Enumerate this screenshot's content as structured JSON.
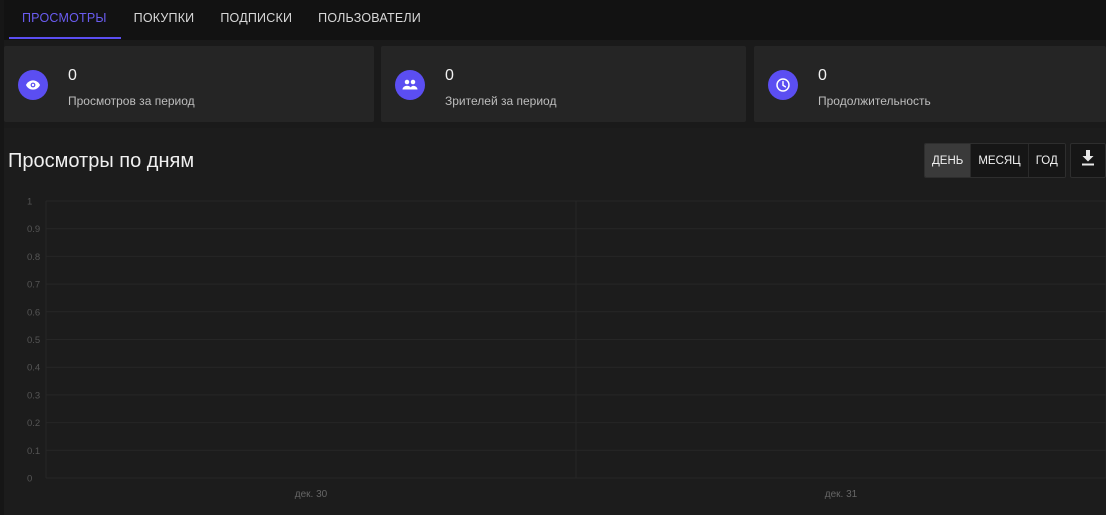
{
  "tabs": [
    {
      "label": "ПРОСМОТРЫ",
      "active": true
    },
    {
      "label": "ПОКУПКИ",
      "active": false
    },
    {
      "label": "ПОДПИСКИ",
      "active": false
    },
    {
      "label": "ПОЛЬЗОВАТЕЛИ",
      "active": false
    }
  ],
  "cards": [
    {
      "icon": "eye-icon",
      "value": "0",
      "label": "Просмотров за период"
    },
    {
      "icon": "users-icon",
      "value": "0",
      "label": "Зрителей за период"
    },
    {
      "icon": "clock-icon",
      "value": "0",
      "label": "Продолжительность"
    }
  ],
  "panel": {
    "title": "Просмотры по дням",
    "period_buttons": [
      {
        "label": "ДЕНЬ",
        "active": true
      },
      {
        "label": "МЕСЯЦ",
        "active": false
      },
      {
        "label": "ГОД",
        "active": false
      }
    ],
    "download_icon": "download-icon"
  },
  "colors": {
    "accent": "#5b4ef2",
    "background": "#1a1a1a",
    "card": "#252525"
  },
  "chart_data": {
    "type": "line",
    "x": [
      "дек. 30",
      "дек. 31"
    ],
    "series": [
      {
        "values": [
          0,
          0
        ]
      }
    ],
    "ylim": [
      0,
      1
    ],
    "yticks": [
      "0",
      "0.1",
      "0.2",
      "0.3",
      "0.4",
      "0.5",
      "0.6",
      "0.7",
      "0.8",
      "0.9",
      "1"
    ],
    "grid": true
  }
}
